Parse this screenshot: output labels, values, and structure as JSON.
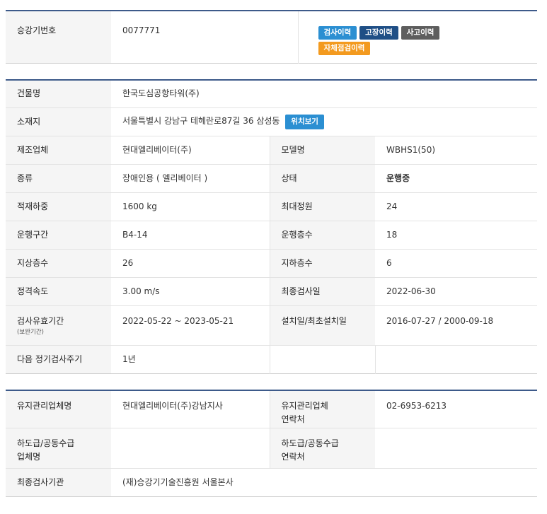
{
  "elevator": {
    "number_label": "승강기번호",
    "number_value": "0077771",
    "buttons": {
      "inspection_history": "검사이력",
      "failure_history": "고장이력",
      "accident_history": "사고이력",
      "self_inspection_history": "자체점검이력"
    }
  },
  "building": {
    "name_label": "건물명",
    "name_value": "한국도심공항타워(주)",
    "address_label": "소재지",
    "address_value": "서울특별시 강남구 테헤란로87길 36 삼성동",
    "location_button": "위치보기",
    "manufacturer_label": "제조업체",
    "manufacturer_value": "현대엘리베이터(주)",
    "model_label": "모델명",
    "model_value": "WBHS1(50)",
    "type_label": "종류",
    "type_value": "장애인용 ( 엘리베이터 )",
    "status_label": "상태",
    "status_value": "운행중",
    "load_label": "적재하중",
    "load_value": "1600 kg",
    "capacity_label": "최대정원",
    "capacity_value": "24",
    "section_label": "운행구간",
    "section_value": "B4-14",
    "floors_label": "운행층수",
    "floors_value": "18",
    "above_label": "지상층수",
    "above_value": "26",
    "below_label": "지하층수",
    "below_value": "6",
    "speed_label": "정격속도",
    "speed_value": "3.00 m/s",
    "last_insp_label": "최종검사일",
    "last_insp_value": "2022-06-30",
    "valid_label": "검사유효기간",
    "valid_sub": "(보완기간)",
    "valid_value": "2022-05-22 ~ 2023-05-21",
    "install_label": "설치일/최초설치일",
    "install_value": "2016-07-27 / 2000-09-18",
    "cycle_label": "다음 정기검사주기",
    "cycle_value": "1년"
  },
  "maintenance": {
    "company_label": "유지관리업체명",
    "company_value": "현대엘리베이터(주)강남지사",
    "contact_label_1": "유지관리업체",
    "contact_label_2": "연락처",
    "contact_value": "02-6953-6213",
    "sub_label_1": "하도급/공동수급",
    "sub_label_2": "업체명",
    "sub_value": "",
    "sub_contact_label_1": "하도급/공동수급",
    "sub_contact_label_2": "연락처",
    "sub_contact_value": "",
    "agency_label": "최종검사기관",
    "agency_value": "(재)승강기기술진흥원 서울본사"
  }
}
